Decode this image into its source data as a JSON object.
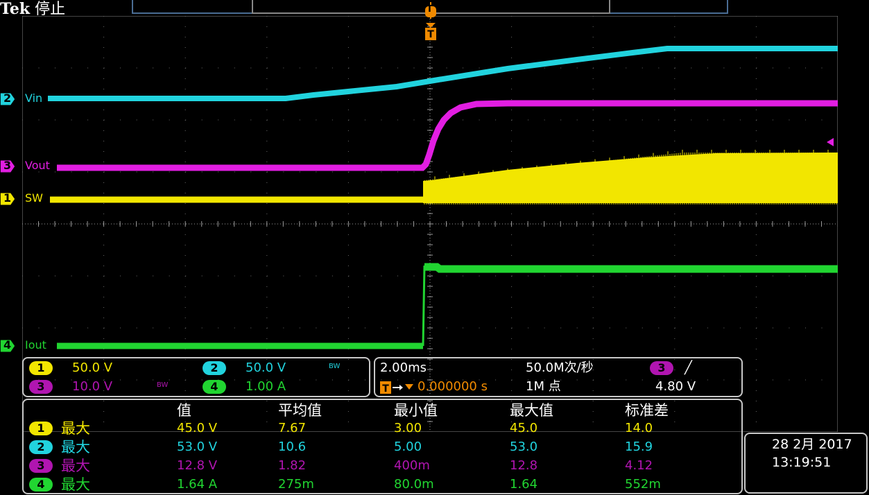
{
  "brand": {
    "logo": "Tek",
    "status": "停止"
  },
  "trigger": {
    "badge": "T"
  },
  "channels": [
    {
      "num": "1",
      "label": "SW",
      "color": "#f2e600",
      "scale": "50.0 V",
      "bw": ""
    },
    {
      "num": "2",
      "label": "Vin",
      "color": "#21d3de",
      "scale": "50.0 V",
      "bw": "BW"
    },
    {
      "num": "3",
      "label": "Vout",
      "color": "#e21ee2",
      "scale": "10.0 V",
      "bw": "BW"
    },
    {
      "num": "4",
      "label": "Iout",
      "color": "#21d531",
      "scale": "1.00 A",
      "bw": ""
    }
  ],
  "acquisition": {
    "timebase": "2.00ms",
    "sample_rate": "50.0M次/秒",
    "trigger_position": "0.000000 s",
    "record_length": "1M 点",
    "trigger_source": "3",
    "trigger_slope": "╱",
    "trigger_level": "4.80 V"
  },
  "measurements": {
    "headers": [
      "值",
      "平均值",
      "最小值",
      "最大值",
      "标准差"
    ],
    "rows": [
      {
        "ch": "1",
        "type": "最大",
        "value": "45.0 V",
        "mean": "7.67",
        "min": "3.00",
        "max": "45.0",
        "std": "14.0"
      },
      {
        "ch": "2",
        "type": "最大",
        "value": "53.0 V",
        "mean": "10.6",
        "min": "5.00",
        "max": "53.0",
        "std": "15.9"
      },
      {
        "ch": "3",
        "type": "最大",
        "value": "12.8 V",
        "mean": "1.82",
        "min": "400m",
        "max": "12.8",
        "std": "4.12"
      },
      {
        "ch": "4",
        "type": "最大",
        "value": "1.64 A",
        "mean": "275m",
        "min": "80.0m",
        "max": "1.64",
        "std": "552m"
      }
    ]
  },
  "datetime": {
    "date": "28 2月 2017",
    "time": "13:19:51"
  }
}
